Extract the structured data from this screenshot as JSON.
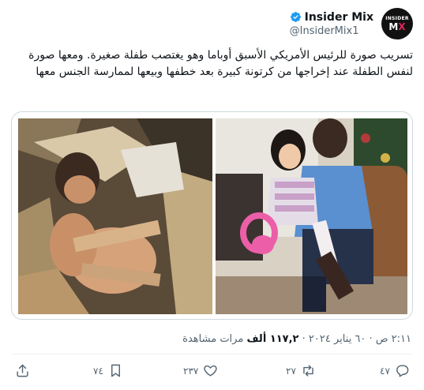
{
  "author": {
    "display_name": "Insider Mix",
    "handle": "@InsiderMix1",
    "avatar_line1": "INSIDER",
    "avatar_line2_a": "M",
    "avatar_line2_b": "X",
    "avatar_line2_c": "I",
    "verified_color": "#1d9bf0"
  },
  "tweet": {
    "text": "تسريب صورة للرئيس الأمريكي الأسبق أوباما وهو يغتصب طفلة صغيرة. ومعها صورة لنفس الطفلة عند إخراجها من كرتونة كبيرة بعد خطفها وبيعها لممارسة الجنس معها"
  },
  "meta": {
    "time": "٢:١١ ص",
    "separator": "·",
    "date": "٦٠ يناير ٢٠٢٤",
    "views_count": "١١٧,٢ ألف",
    "views_label": "مرات مشاهدة"
  },
  "actions": {
    "replies": "٤٧",
    "retweets": "٢٧",
    "likes": "٢٣٧",
    "bookmarks": "٧٤"
  },
  "icons": {
    "reply": "reply-icon",
    "retweet": "retweet-icon",
    "like": "heart-icon",
    "bookmark": "bookmark-icon",
    "share": "share-icon"
  }
}
